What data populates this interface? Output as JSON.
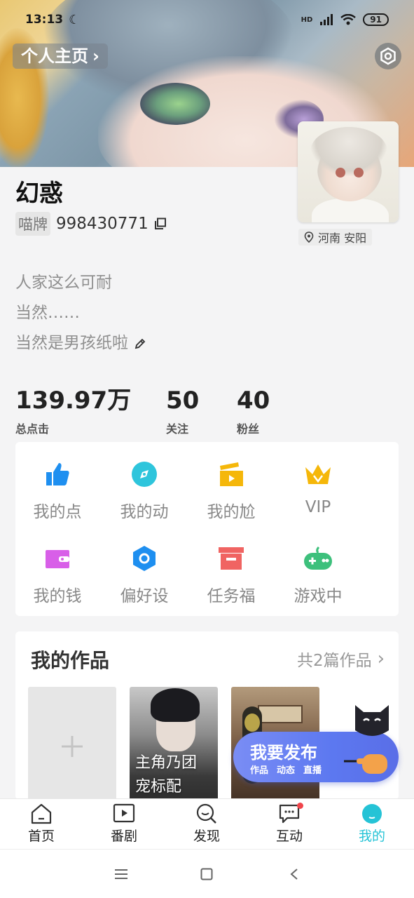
{
  "status_bar": {
    "time": "13:13",
    "battery": "91",
    "network": "HD"
  },
  "header": {
    "homepage_label": "个人主页"
  },
  "profile": {
    "username": "幻惑",
    "id_badge": "喵牌",
    "id_number": "998430771",
    "location": "河南 安阳",
    "bio": [
      "人家这么可耐",
      "当然……",
      "当然是男孩纸啦"
    ]
  },
  "stats": [
    {
      "value": "139.97万",
      "label": "总点击"
    },
    {
      "value": "50",
      "label": "关注"
    },
    {
      "value": "40",
      "label": "粉丝"
    }
  ],
  "menu": [
    {
      "label": "我的点",
      "icon": "thumbs-up-icon",
      "color": "#1e8ff0"
    },
    {
      "label": "我的动",
      "icon": "compass-icon",
      "color": "#2ec5dc"
    },
    {
      "label": "我的尬",
      "icon": "clapperboard-icon",
      "color": "#f5b70a"
    },
    {
      "label": "VIP",
      "icon": "crown-icon",
      "color": "#f5b70a"
    },
    {
      "label": "我的钱",
      "icon": "wallet-icon",
      "color": "#d85fe8"
    },
    {
      "label": "偏好设",
      "icon": "hexagon-settings-icon",
      "color": "#1e8ff0"
    },
    {
      "label": "任务福",
      "icon": "gift-box-icon",
      "color": "#f06462"
    },
    {
      "label": "游戏中",
      "icon": "gamepad-icon",
      "color": "#3dc07c"
    }
  ],
  "works": {
    "title": "我的作品",
    "count_label": "共2篇作品",
    "items": [
      {
        "title_lines": [
          "主角乃团",
          "宠标配"
        ]
      }
    ]
  },
  "fab": {
    "label": "我要发布",
    "options": [
      "作品",
      "动态",
      "直播"
    ]
  },
  "tabbar": [
    {
      "label": "首页",
      "icon": "home-icon",
      "active": false
    },
    {
      "label": "番剧",
      "icon": "play-icon",
      "active": false
    },
    {
      "label": "发现",
      "icon": "search-icon",
      "active": false
    },
    {
      "label": "互动",
      "icon": "chat-icon",
      "active": false,
      "badge": true
    },
    {
      "label": "我的",
      "icon": "profile-icon",
      "active": true
    }
  ]
}
